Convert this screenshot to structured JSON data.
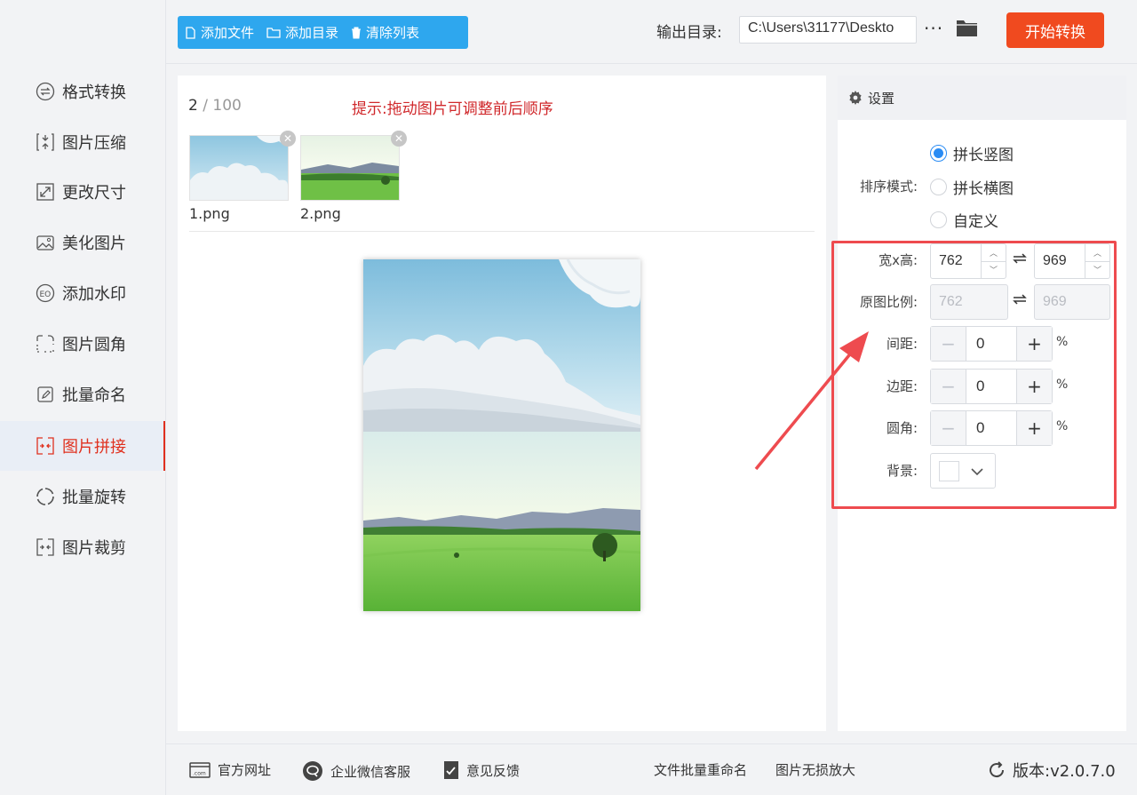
{
  "sidebar": {
    "items": [
      {
        "label": "格式转换",
        "icon": "format-convert-icon"
      },
      {
        "label": "图片压缩",
        "icon": "compress-icon"
      },
      {
        "label": "更改尺寸",
        "icon": "resize-icon"
      },
      {
        "label": "美化图片",
        "icon": "beautify-icon"
      },
      {
        "label": "添加水印",
        "icon": "watermark-icon"
      },
      {
        "label": "图片圆角",
        "icon": "rounded-corner-icon"
      },
      {
        "label": "批量命名",
        "icon": "rename-icon"
      },
      {
        "label": "图片拼接",
        "icon": "stitch-icon",
        "active": true
      },
      {
        "label": "批量旋转",
        "icon": "rotate-icon"
      },
      {
        "label": "图片裁剪",
        "icon": "crop-icon"
      }
    ]
  },
  "toolbar": {
    "add_file": "添加文件",
    "add_folder": "添加目录",
    "clear_list": "清除列表",
    "output_label": "输出目录:",
    "output_path": "C:\\Users\\31177\\Deskto",
    "more": "···",
    "start": "开始转换"
  },
  "main": {
    "count": "2",
    "count_sep": " / ",
    "count_max": "100",
    "tip": "提示:拖动图片可调整前后顺序",
    "files": [
      {
        "name": "1.png"
      },
      {
        "name": "2.png"
      }
    ]
  },
  "settings": {
    "title": "设置",
    "sort_label": "排序模式:",
    "sort_options": [
      "拼长竖图",
      "拼长横图",
      "自定义"
    ],
    "sort_selected": "拼长竖图",
    "size_label": "宽x高:",
    "width": "762",
    "height": "969",
    "ratio_label": "原图比例:",
    "ratio_width": "762",
    "ratio_height": "969",
    "spacing_label": "间距:",
    "spacing": "0",
    "margin_label": "边距:",
    "margin": "0",
    "radius_label": "圆角:",
    "radius": "0",
    "percent": "%",
    "bg_label": "背景:",
    "bg_color": "#ffffff"
  },
  "footer": {
    "website": "官方网址",
    "wechat": "企业微信客服",
    "feedback": "意见反馈",
    "batch_rename": "文件批量重命名",
    "lossless": "图片无损放大",
    "version": "版本:v2.0.7.0"
  },
  "colors": {
    "accent_blue": "#2ea7ee",
    "start_orange": "#f04a1f",
    "active_red": "#e0301e",
    "highlight_red": "#ee4b4f"
  }
}
